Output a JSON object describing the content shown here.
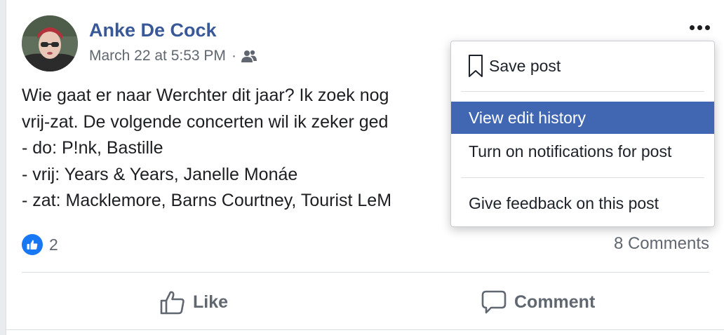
{
  "post": {
    "author": "Anke De Cock",
    "timestamp": "March 22 at 5:53 PM",
    "meta_separator": "·",
    "audience_icon": "friends-icon",
    "text_lines": [
      "Wie gaat er naar Werchter dit jaar? Ik zoek nog",
      "vrij-zat. De volgende concerten wil ik zeker ged",
      "- do: P!nk, Bastille",
      "- vrij: Years & Years, Janelle Monáe",
      "- zat: Macklemore, Barns Courtney, Tourist LeM"
    ],
    "reaction_count": "2",
    "comments_count": "8 Comments"
  },
  "actions": {
    "like_label": "Like",
    "comment_label": "Comment"
  },
  "menu": {
    "items": [
      {
        "label": "Save post",
        "icon": "bookmark-icon"
      },
      {
        "label": "View edit history",
        "highlighted": true
      },
      {
        "label": "Turn on notifications for post"
      },
      {
        "label": "Give feedback on this post"
      }
    ]
  },
  "colors": {
    "author": "#385898",
    "highlight": "#4267b2",
    "like_blue": "#1877f2",
    "secondary_text": "#616770"
  }
}
